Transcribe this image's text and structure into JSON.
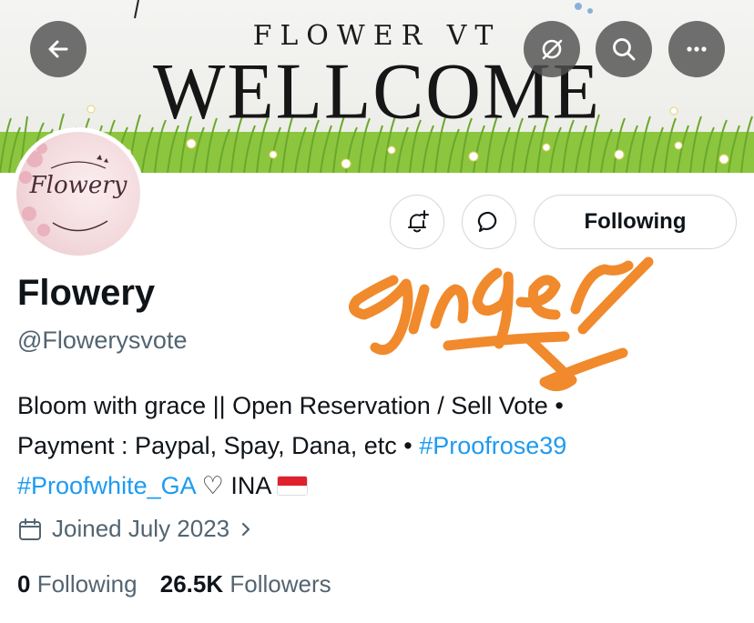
{
  "banner": {
    "subtitle": "FLOWER VT",
    "title": "WELLCOME"
  },
  "nav": {
    "back_icon": "arrow-left-icon",
    "grok_icon": "grok-icon",
    "search_icon": "search-icon",
    "more_icon": "more-horizontal-icon"
  },
  "avatar": {
    "text": "Flowery"
  },
  "actions": {
    "notify_icon": "bell-plus-icon",
    "message_icon": "message-bubble-icon",
    "follow_label": "Following"
  },
  "profile": {
    "name": "Flowery",
    "handle": "@Flowerysvote",
    "bio_line1": "Bloom with grace || Open Reservation / Sell Vote •",
    "bio_line2_text": "Payment : Paypal, Spay, Dana, etc • ",
    "bio_tag1": "#Proofrose39",
    "bio_tag2": "#Proofwhite_GA",
    "bio_tail": " ♡ INA",
    "joined": "Joined July 2023",
    "following_count": "0",
    "following_label": "Following",
    "followers_count": "26.5K",
    "followers_label": "Followers"
  },
  "colors": {
    "link": "#1d9bf0",
    "secondary_text": "#536471",
    "scribble": "#f08a2c"
  }
}
